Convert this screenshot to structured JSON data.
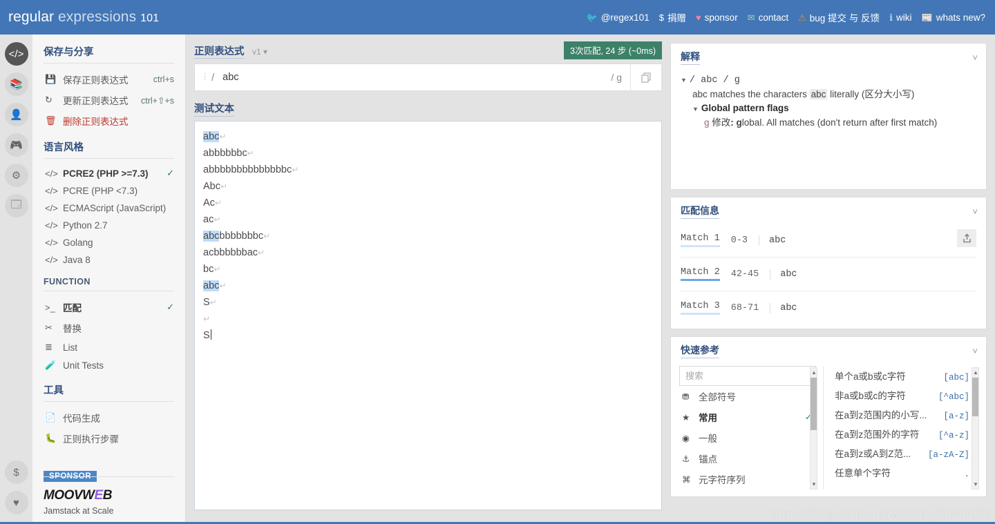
{
  "header": {
    "brand": {
      "word1": "regular",
      "word2": "expressions",
      "word3": "101"
    },
    "nav": [
      {
        "icon": "twitter-icon",
        "glyph": "🐦",
        "label": "@regex101"
      },
      {
        "icon": "dollar-icon",
        "glyph": "$",
        "label": "捐赠"
      },
      {
        "icon": "heart-icon",
        "glyph": "♥",
        "label": "sponsor"
      },
      {
        "icon": "mail-icon",
        "glyph": "✉",
        "label": "contact"
      },
      {
        "icon": "warning-icon",
        "glyph": "⚠",
        "label": "bug 提交 与 反馈"
      },
      {
        "icon": "wiki-icon",
        "glyph": "ℹ",
        "label": "wiki"
      },
      {
        "icon": "news-icon",
        "glyph": "📰",
        "label": "whats new?"
      }
    ]
  },
  "rail": [
    {
      "name": "code-icon",
      "glyph": "</>",
      "active": true
    },
    {
      "name": "library-icon",
      "glyph": "📚",
      "active": false
    },
    {
      "name": "account-icon",
      "glyph": "👤",
      "active": false
    },
    {
      "name": "gamepad-icon",
      "glyph": "🎮",
      "active": false
    },
    {
      "name": "gear-icon",
      "glyph": "⚙",
      "active": false
    },
    {
      "name": "chat-icon",
      "glyph": "🗔",
      "active": false
    }
  ],
  "rail_bottom": [
    {
      "name": "donate-icon",
      "glyph": "$"
    },
    {
      "name": "favorite-icon",
      "glyph": "♥"
    }
  ],
  "sidebar": {
    "save_share_title": "保存与分享",
    "save_share_items": [
      {
        "icon": "save-icon",
        "glyph": "💾",
        "label": "保存正则表达式",
        "shortcut": "ctrl+s",
        "danger": false
      },
      {
        "icon": "refresh-icon",
        "glyph": "↻",
        "label": "更新正则表达式",
        "shortcut": "ctrl+⇧+s",
        "danger": false
      },
      {
        "icon": "trash-icon",
        "glyph": "🗑",
        "label": "删除正则表达式",
        "shortcut": "",
        "danger": true
      }
    ],
    "flavor_title": "语言风格",
    "flavors": [
      {
        "label": "PCRE2 (PHP >=7.3)",
        "selected": true
      },
      {
        "label": "PCRE (PHP <7.3)",
        "selected": false
      },
      {
        "label": "ECMAScript (JavaScript)",
        "selected": false
      },
      {
        "label": "Python 2.7",
        "selected": false
      },
      {
        "label": "Golang",
        "selected": false
      },
      {
        "label": "Java 8",
        "selected": false
      }
    ],
    "function_title": "FUNCTION",
    "functions": [
      {
        "icon": "terminal-icon",
        "glyph": ">_",
        "label": "匹配",
        "selected": true
      },
      {
        "icon": "scissors-icon",
        "glyph": "✂",
        "label": "替换",
        "selected": false
      },
      {
        "icon": "list-icon",
        "glyph": "≣",
        "label": "List",
        "selected": false
      },
      {
        "icon": "test-tube-icon",
        "glyph": "🧪",
        "label": "Unit Tests",
        "selected": false
      }
    ],
    "tools_title": "工具",
    "tools": [
      {
        "icon": "code-file-icon",
        "glyph": "📄",
        "label": "代码生成"
      },
      {
        "icon": "bug-icon",
        "glyph": "🐛",
        "label": "正则执行步骤"
      }
    ],
    "sponsor": {
      "tag": "SPONSOR",
      "logo_a": "MOOVW",
      "logo_e": "E",
      "logo_b": "B",
      "tagline": "Jamstack at Scale"
    }
  },
  "editor": {
    "regex_title": "正则表达式",
    "version": "v1",
    "match_badge": "3次匹配, 24 步 (~0ms)",
    "pattern": "abc",
    "pattern_placeholder": "",
    "delimiter": "/",
    "flags": "/ g",
    "copy_icon": "copy-icon",
    "test_title": "测试文本",
    "test_lines": [
      {
        "pre": "",
        "match": "abc",
        "post": "",
        "br": true
      },
      {
        "pre": "abbbbbbc",
        "match": "",
        "post": "",
        "br": true
      },
      {
        "pre": "abbbbbbbbbbbbbbc",
        "match": "",
        "post": "",
        "br": true
      },
      {
        "pre": "Abc",
        "match": "",
        "post": "",
        "br": true
      },
      {
        "pre": "Ac",
        "match": "",
        "post": "",
        "br": true
      },
      {
        "pre": "ac",
        "match": "",
        "post": "",
        "br": true
      },
      {
        "pre": "",
        "match": "abc",
        "post": "bbbbbbbc",
        "br": true
      },
      {
        "pre": "acbbbbbbac",
        "match": "",
        "post": "",
        "br": true
      },
      {
        "pre": "bc",
        "match": "",
        "post": "",
        "br": true
      },
      {
        "pre": "",
        "match": "abc",
        "post": "",
        "br": true
      },
      {
        "pre": "S",
        "match": "",
        "post": "",
        "br": true
      },
      {
        "pre": "",
        "match": "",
        "post": "",
        "br": true
      },
      {
        "pre": "S",
        "match": "",
        "post": "",
        "br": false,
        "caret": true
      }
    ]
  },
  "explanation": {
    "title": "解释",
    "pattern_line": "/ abc / g",
    "desc_pre": "abc matches the characters ",
    "desc_chip": "abc",
    "desc_post": " literally (区分大小写)",
    "flags_title": "Global pattern flags",
    "flag_key": "g",
    "flag_label": "修改",
    "flag_desc_bold": "g",
    "flag_desc": "lobal. All matches (don't return after first match)"
  },
  "matches": {
    "title": "匹配信息",
    "share_icon": "share-icon",
    "rows": [
      {
        "name": "Match 1",
        "range": "0-3",
        "value": "abc",
        "hover": false
      },
      {
        "name": "Match 2",
        "range": "42-45",
        "value": "abc",
        "hover": true
      },
      {
        "name": "Match 3",
        "range": "68-71",
        "value": "abc",
        "hover": false
      }
    ]
  },
  "quickref": {
    "title": "快速参考",
    "search_placeholder": "搜索",
    "search_value": "",
    "categories": [
      {
        "icon": "all-tokens-icon",
        "glyph": "⛃",
        "label": "全部符号",
        "selected": false
      },
      {
        "icon": "star-icon",
        "glyph": "★",
        "label": "常用",
        "selected": true
      },
      {
        "icon": "circle-dot-icon",
        "glyph": "◉",
        "label": "一般",
        "selected": false
      },
      {
        "icon": "anchor-icon",
        "glyph": "⚓",
        "label": "锚点",
        "selected": false
      },
      {
        "icon": "meta-icon",
        "glyph": "⌘",
        "label": "元字符序列",
        "selected": false
      }
    ],
    "items": [
      {
        "label": "单个a或b或c字符",
        "token": "[abc]"
      },
      {
        "label": "非a或b或c的字符",
        "token": "[^abc]"
      },
      {
        "label": "在a到z范围内的小写...",
        "token": "[a-z]"
      },
      {
        "label": "在a到z范围外的字符",
        "token": "[^a-z]"
      },
      {
        "label": "在a到z或A到Z范...",
        "token": "[a-zA-Z]"
      },
      {
        "label": "任意单个字符",
        "token": "."
      }
    ]
  },
  "watermark": "https://blog.csdn.net/weixin_54646993"
}
